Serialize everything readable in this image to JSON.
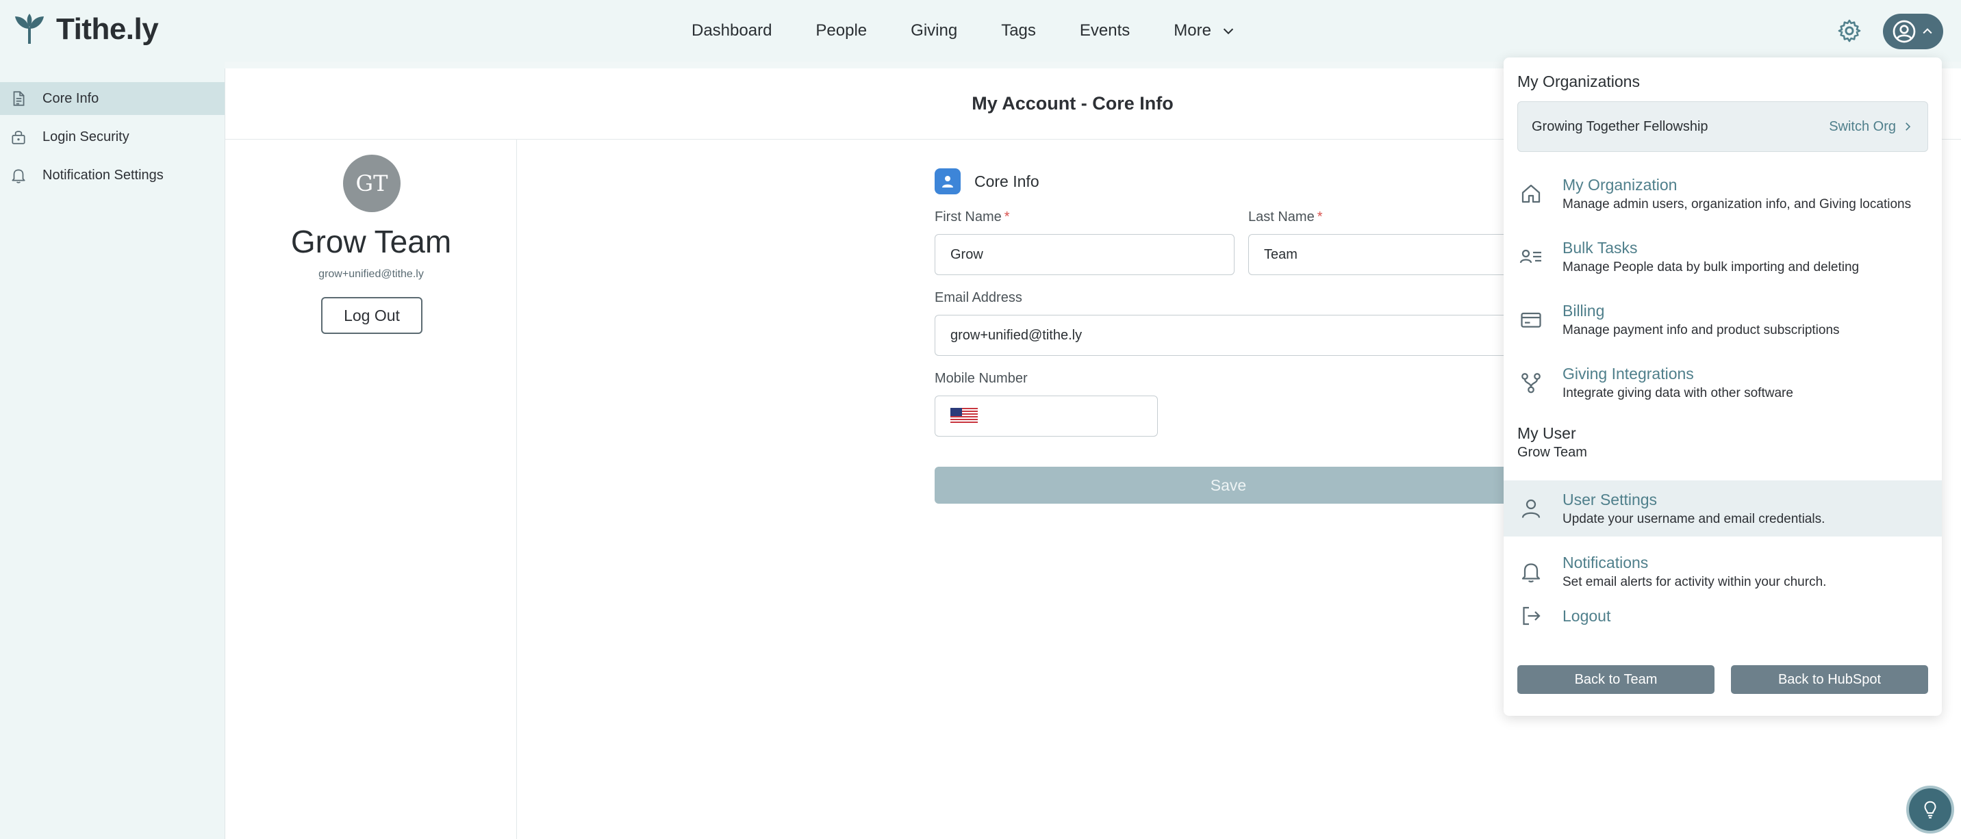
{
  "app": {
    "name": "Tithe.ly"
  },
  "nav": {
    "items": [
      {
        "label": "Dashboard"
      },
      {
        "label": "People"
      },
      {
        "label": "Giving"
      },
      {
        "label": "Tags"
      },
      {
        "label": "Events"
      },
      {
        "label": "More"
      }
    ]
  },
  "sidebar": {
    "items": [
      {
        "label": "Core Info"
      },
      {
        "label": "Login Security"
      },
      {
        "label": "Notification Settings"
      }
    ]
  },
  "page": {
    "title": "My Account - Core Info"
  },
  "profile": {
    "initials": "GT",
    "name": "Grow Team",
    "email": "grow+unified@tithe.ly",
    "logout_label": "Log Out"
  },
  "form": {
    "section_title": "Core Info",
    "first_name_label": "First Name",
    "first_name_value": "Grow",
    "last_name_label": "Last Name",
    "last_name_value": "Team",
    "required_mark": "*",
    "email_label": "Email Address",
    "email_value": "grow+unified@tithe.ly",
    "mobile_label": "Mobile Number",
    "mobile_value": "",
    "save_label": "Save"
  },
  "dropdown": {
    "orgs_heading": "My Organizations",
    "org_name": "Growing Together Fellowship",
    "switch_org_label": "Switch Org",
    "org_items": [
      {
        "title": "My Organization",
        "subtitle": "Manage admin users, organization info, and Giving locations",
        "icon": "home-icon"
      },
      {
        "title": "Bulk Tasks",
        "subtitle": "Manage People data by bulk importing and deleting",
        "icon": "user-list-icon"
      },
      {
        "title": "Billing",
        "subtitle": "Manage payment info and product subscriptions",
        "icon": "credit-card-icon"
      },
      {
        "title": "Giving Integrations",
        "subtitle": "Integrate giving data with other software",
        "icon": "integration-icon"
      }
    ],
    "user_heading": "My User",
    "user_name": "Grow Team",
    "user_items": [
      {
        "title": "User Settings",
        "subtitle": "Update your username and email credentials.",
        "icon": "user-icon"
      },
      {
        "title": "Notifications",
        "subtitle": "Set email alerts for activity within your church.",
        "icon": "bell-icon"
      },
      {
        "title": "Logout",
        "subtitle": "",
        "icon": "logout-icon"
      }
    ],
    "back_team_label": "Back to Team",
    "back_hubspot_label": "Back to HubSpot"
  },
  "colors": {
    "accent": "#4f7f8b",
    "brand_dark": "#4d6e7c",
    "save_disabled": "#a4bcc3",
    "badge_blue": "#3d85d8"
  }
}
